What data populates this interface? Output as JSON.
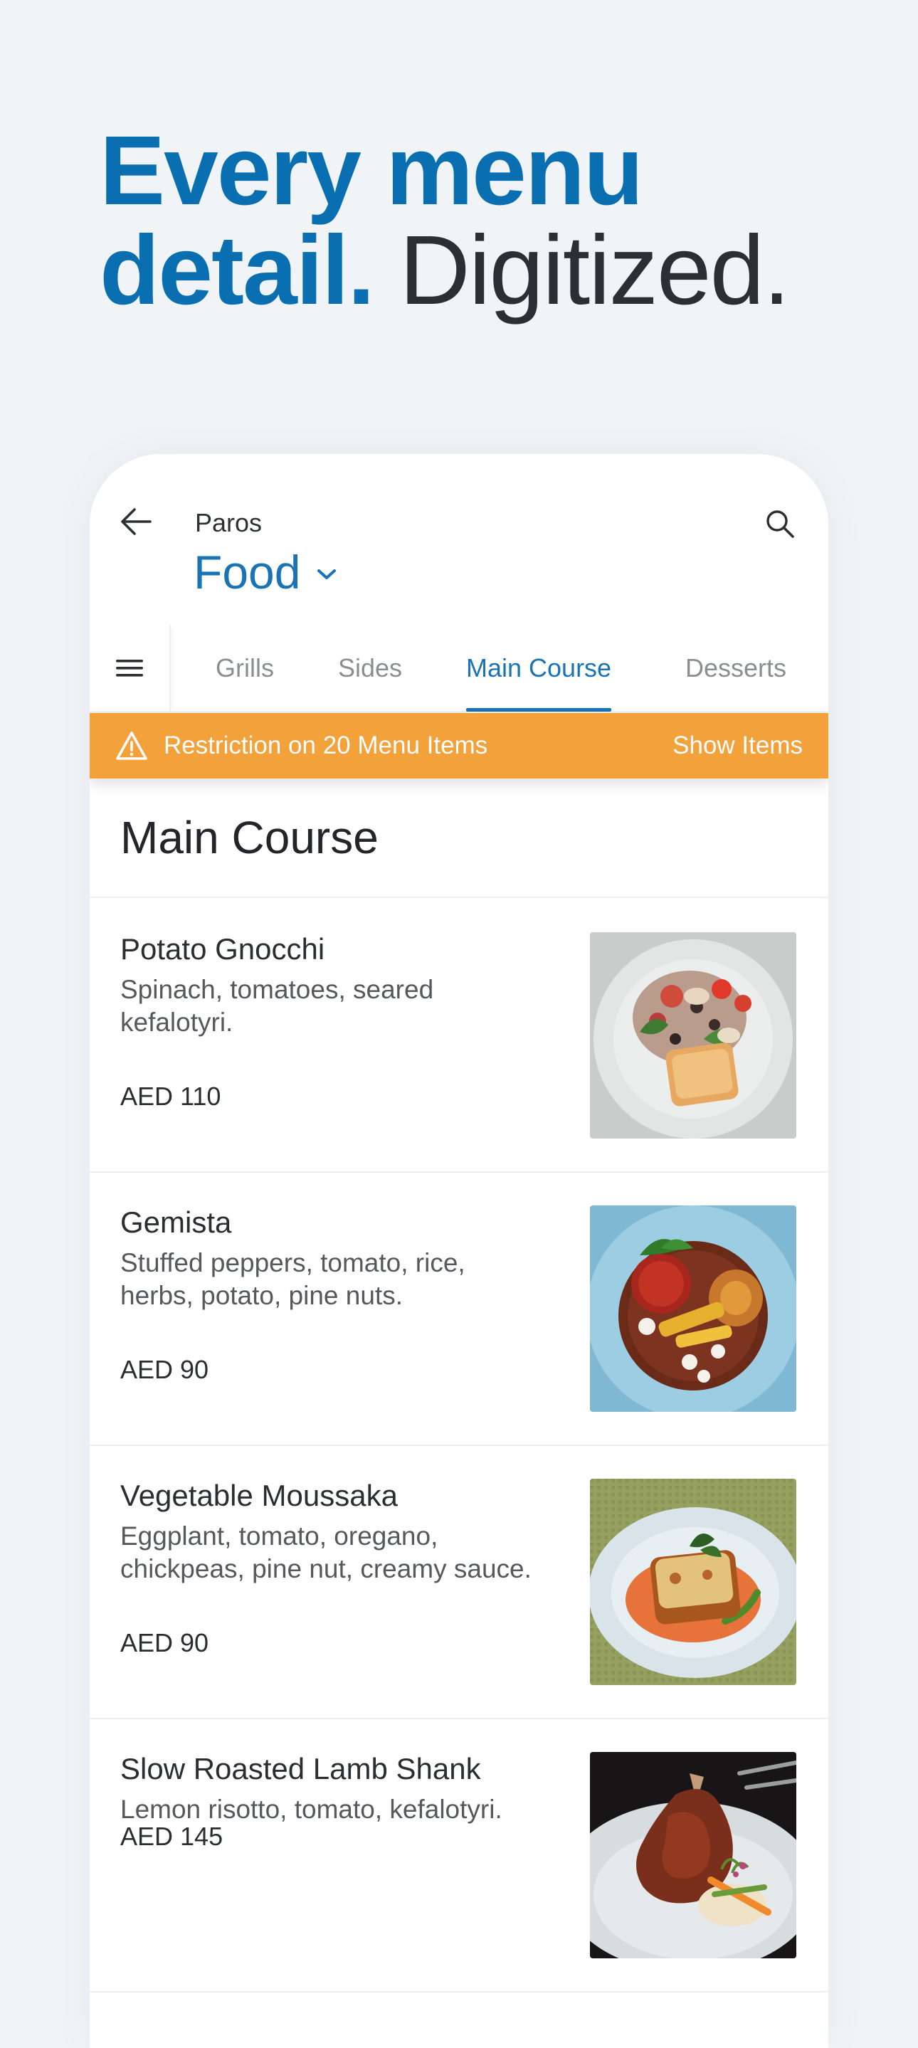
{
  "headline": {
    "line1": "Every menu",
    "line2_bold": "detail.",
    "line2_light": "Digitized."
  },
  "header": {
    "venue": "Paros",
    "menu": "Food"
  },
  "tabs": [
    {
      "label": "Grills",
      "active": false
    },
    {
      "label": "Sides",
      "active": false
    },
    {
      "label": "Main Course",
      "active": true
    },
    {
      "label": "Desserts",
      "active": false
    }
  ],
  "banner": {
    "message": "Restriction on 20 Menu Items",
    "action": "Show Items",
    "color": "#f3a13b"
  },
  "section": {
    "title": "Main Course"
  },
  "items": [
    {
      "name": "Potato Gnocchi",
      "desc_line1": "Spinach, tomatoes, seared",
      "desc_line2": "kefalotyri.",
      "price": "AED 110",
      "image": "gnocchi-dish-photo"
    },
    {
      "name": "Gemista",
      "desc_line1": "Stuffed peppers, tomato, rice,",
      "desc_line2": "herbs, potato, pine nuts.",
      "price": "AED 90",
      "image": "gemista-dish-photo"
    },
    {
      "name": "Vegetable Moussaka",
      "desc_line1": "Eggplant, tomato, oregano,",
      "desc_line2": "chickpeas, pine nut, creamy sauce.",
      "price": "AED 90",
      "image": "moussaka-dish-photo"
    },
    {
      "name": "Slow Roasted Lamb Shank",
      "desc_line1": "Lemon risotto, tomato, kefalotyri.",
      "desc_line2": "",
      "price": "AED 145",
      "image": "lamb-shank-dish-photo"
    }
  ],
  "colors": {
    "brand_blue": "#0a6fb0",
    "accent_blue": "#1a73b5",
    "warning_orange": "#f3a13b",
    "background": "#f1f4f7"
  },
  "icons": {
    "back": "arrow-left-icon",
    "search": "search-icon",
    "dropdown": "chevron-down-icon",
    "menu": "hamburger-icon",
    "warning": "warning-triangle-icon"
  }
}
